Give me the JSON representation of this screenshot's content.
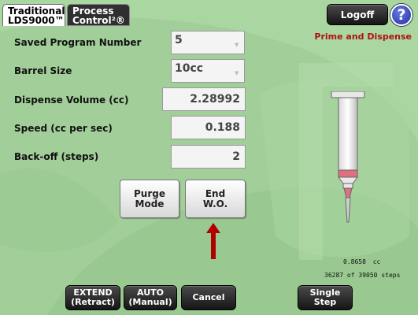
{
  "tabs": {
    "traditional": [
      "Traditional",
      "LDS9000™"
    ],
    "process": [
      "Process",
      "Control²®"
    ]
  },
  "header": {
    "logoff_label": "Logoff",
    "help_label": "?",
    "mode_title": "Prime and Dispense"
  },
  "fields": [
    {
      "label": "Saved Program Number",
      "value": "5",
      "type": "select"
    },
    {
      "label": "Barrel Size",
      "value": "10cc",
      "type": "select"
    },
    {
      "label": "Dispense Volume (cc)",
      "value": "2.28992",
      "type": "value"
    },
    {
      "label": "Speed (cc per sec)",
      "value": "0.188",
      "type": "value"
    },
    {
      "label": "Back-off (steps)",
      "value": "2",
      "type": "value"
    }
  ],
  "actions": {
    "purge": [
      "Purge",
      "Mode"
    ],
    "end": [
      "End",
      "W.O."
    ]
  },
  "readout": {
    "volume": "0.8658",
    "volume_unit": "cc",
    "steps_current": "36287",
    "steps_of": "of",
    "steps_total": "39050",
    "steps_unit": "steps"
  },
  "bottom": {
    "extend": [
      "EXTEND",
      "(Retract)"
    ],
    "auto": [
      "AUTO",
      "(Manual)"
    ],
    "cancel": "Cancel",
    "single_step": "Single Step"
  },
  "colors": {
    "background": "#9fce96",
    "mode_title": "#b01010",
    "arrow": "#b00000",
    "help": "#1f2fa8"
  },
  "icons": {
    "help": "question-circle-icon",
    "arrow": "up-arrow-icon",
    "syringe": "syringe-icon"
  }
}
